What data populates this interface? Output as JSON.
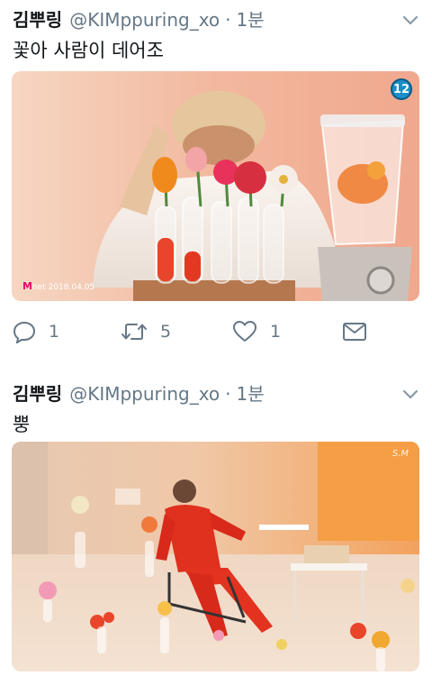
{
  "tweets": [
    {
      "user_name": "김뿌링",
      "handle": "@KIMppuring_xo",
      "separator": "·",
      "time": "1분",
      "text": "꽃아 사람이 데어조",
      "media": {
        "badge": "12",
        "brand_logo": "M",
        "brand_suffix": "net",
        "brand_date": "2018.04.05"
      },
      "actions": {
        "reply_count": "1",
        "retweet_count": "5",
        "like_count": "1"
      }
    },
    {
      "user_name": "김뿌링",
      "handle": "@KIMppuring_xo",
      "separator": "·",
      "time": "1분",
      "text": "뿡",
      "media": {
        "watermark": "S.M"
      }
    }
  ],
  "icons": {
    "reply": "reply-icon",
    "retweet": "retweet-icon",
    "like": "heart-icon",
    "dm": "envelope-icon",
    "more": "chevron-down-icon"
  },
  "colors": {
    "secondary_text": "#657786",
    "primary_text": "#14171a",
    "badge": "#1b8ec7"
  }
}
